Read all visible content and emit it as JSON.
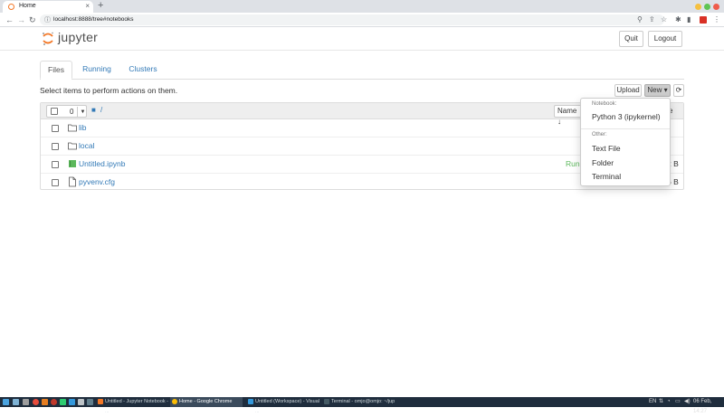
{
  "browser": {
    "tab_title": "Home",
    "tab_close": "×",
    "new_tab": "+",
    "url": "localhost:8888/tree#notebooks",
    "back": "←",
    "forward": "→",
    "reload": "↻"
  },
  "header": {
    "logo_text": "jupyter",
    "quit_label": "Quit",
    "logout_label": "Logout"
  },
  "tabs": [
    {
      "label": "Files"
    },
    {
      "label": "Running"
    },
    {
      "label": "Clusters"
    }
  ],
  "toolbar": {
    "instructions": "Select items to perform actions on them.",
    "upload_label": "Upload",
    "new_label": "New ▾",
    "refresh_icon": "refresh-icon"
  },
  "list_header": {
    "selected_count": "0",
    "path": "/",
    "name_sort": "Name ↓",
    "right_fragment": "e"
  },
  "files": [
    {
      "name": "lib",
      "type": "folder",
      "status": "",
      "size": ""
    },
    {
      "name": "local",
      "type": "folder",
      "status": "",
      "size": ""
    },
    {
      "name": "Untitled.ipynb",
      "type": "notebook",
      "status": "Runn",
      "size": "2 B"
    },
    {
      "name": "pyvenv.cfg",
      "type": "file",
      "status": "",
      "size": "6 B"
    }
  ],
  "dropdown": {
    "notebook_header": "Notebook:",
    "python_kernel": "Python 3 (ipykernel)",
    "other_header": "Other:",
    "text_file": "Text File",
    "folder": "Folder",
    "terminal": "Terminal"
  },
  "taskbar": {
    "tasks": [
      {
        "label": "Untitled - Jupyter Notebook - ..."
      },
      {
        "label": "Home - Google Chrome"
      },
      {
        "label": "Untitled (Workspace) - Visual ..."
      },
      {
        "label": "Terminal - omjo@omjo: ~/jup"
      }
    ],
    "lang": "EN",
    "clock": "06 Feb, 14:27"
  },
  "colors": {
    "link": "#337ab7",
    "accent_orange": "#f37726",
    "running_green": "#5cb85c"
  }
}
